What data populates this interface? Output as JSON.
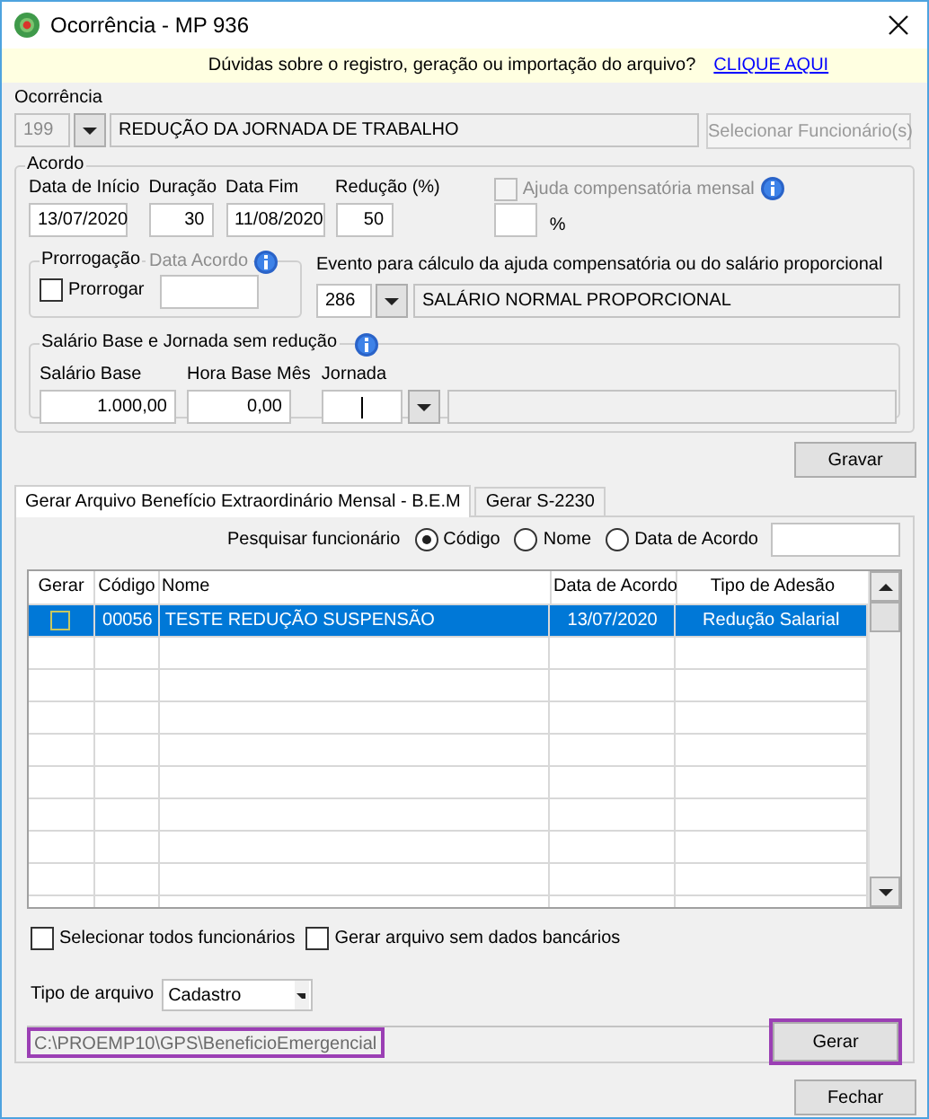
{
  "window": {
    "title": "Ocorrência - MP 936"
  },
  "banner": {
    "text": "Dúvidas sobre o registro, geração ou importação do arquivo?",
    "link": "CLIQUE AQUI"
  },
  "ocorrencia": {
    "label": "Ocorrência",
    "code": "199",
    "description": "REDUÇÃO DA JORNADA DE TRABALHO",
    "select_button": {
      "label": "Selecionar Funcionário(s)",
      "disabled": true
    }
  },
  "acordo": {
    "title": "Acordo",
    "fields": [
      {
        "label": "Data de Início",
        "value": "13/07/2020"
      },
      {
        "label": "Duração",
        "value": "30"
      },
      {
        "label": "Data Fim",
        "value": "11/08/2020"
      },
      {
        "label": "Redução (%)",
        "value": "50"
      }
    ],
    "ajuda": {
      "label": "Ajuda compensatória mensal",
      "checked": false,
      "disabled": true,
      "unit": "%"
    },
    "prorrogacao": {
      "title": "Prorrogação",
      "checkbox": {
        "label": "Prorrogar",
        "checked": false
      },
      "data_acordo_label": "Data Acordo"
    },
    "evento": {
      "label": "Evento para cálculo da ajuda compensatória ou do salário proporcional",
      "code": "286",
      "description": "SALÁRIO NORMAL PROPORCIONAL"
    },
    "salario": {
      "title": "Salário Base e Jornada sem redução",
      "salario_base": {
        "label": "Salário Base",
        "value": "1.000,00"
      },
      "hora_base": {
        "label": "Hora Base Mês",
        "value": "0,00"
      },
      "jornada": {
        "label": "Jornada"
      }
    }
  },
  "gravar_button": "Gravar",
  "tabs": [
    {
      "label": "Gerar Arquivo Benefício Extraordinário Mensal - B.E.M",
      "selected": true
    },
    {
      "label": "Gerar S-2230",
      "selected": false
    }
  ],
  "search": {
    "label": "Pesquisar funcionário",
    "options": [
      {
        "label": "Código",
        "selected": true
      },
      {
        "label": "Nome",
        "selected": false
      },
      {
        "label": "Data de Acordo",
        "selected": false
      }
    ]
  },
  "table": {
    "columns": [
      "Gerar",
      "Código",
      "Nome",
      "Data de Acordo",
      "Tipo de Adesão"
    ],
    "rows": [
      {
        "checked": false,
        "selected": true,
        "codigo": "00056",
        "nome": "TESTE REDUÇÃO SUSPENSÃO",
        "data": "13/07/2020",
        "tipo": "Redução Salarial"
      }
    ]
  },
  "options": [
    {
      "label": "Selecionar todos funcionários",
      "checked": false
    },
    {
      "label": "Gerar arquivo sem dados bancários",
      "checked": false
    }
  ],
  "tipo_arquivo": {
    "label": "Tipo de arquivo",
    "value": "Cadastro"
  },
  "path": {
    "value": "C:\\PROEMP10\\GPS\\BeneficioEmergencial",
    "highlighted": true
  },
  "gerar_button": {
    "label": "Gerar",
    "highlighted": true
  },
  "fechar_button": "Fechar"
}
